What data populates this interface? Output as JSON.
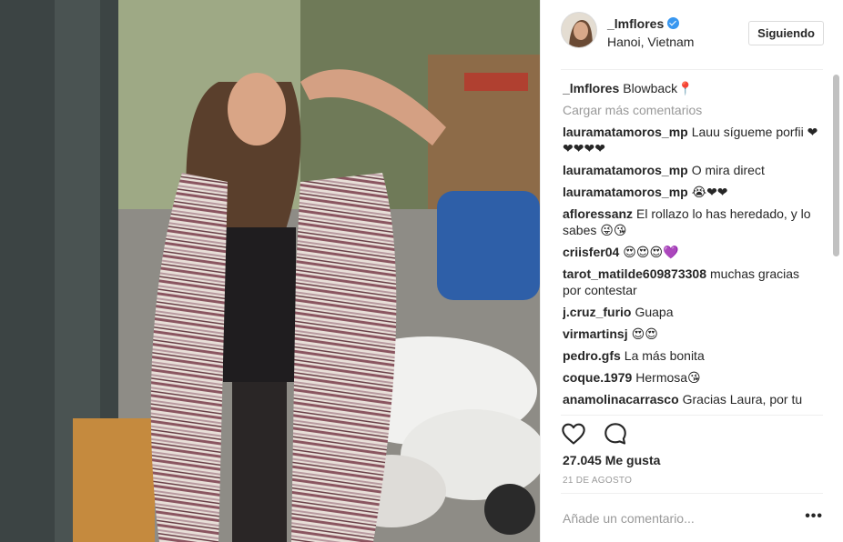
{
  "post": {
    "image_alt": "Photo: woman with striped kimono on a street with parked scooters"
  },
  "header": {
    "username": "_lmflores",
    "location": "Hanoi, Vietnam",
    "follow_label": "Siguiendo"
  },
  "caption": {
    "user": "_lmflores",
    "text": "Blowback📍"
  },
  "load_more": "Cargar más comentarios",
  "comments": [
    {
      "user": "lauramatamoros_mp",
      "text": "Lauu sígueme porfii ❤❤❤❤❤"
    },
    {
      "user": "lauramatamoros_mp",
      "text": "O mira direct"
    },
    {
      "user": "lauramatamoros_mp",
      "text": "😭❤❤"
    },
    {
      "user": "afloressanz",
      "text": "El rollazo lo has heredado, y lo sabes 😜😘"
    },
    {
      "user": "criisfer04",
      "text": "😍😍😍💜"
    },
    {
      "user": "tarot_matilde609873308",
      "text": "muchas gracias por contestar"
    },
    {
      "user": "j.cruz_furio",
      "text": "Guapa"
    },
    {
      "user": "virmartinsj",
      "text": "😍😍"
    },
    {
      "user": "pedro.gfs",
      "text": "La más bonita"
    },
    {
      "user": "coque.1979",
      "text": "Hermosa😘"
    },
    {
      "user": "anamolinacarrasco",
      "text": "Gracias Laura, por tu"
    }
  ],
  "likes": "27.045 Me gusta",
  "date": "21 DE AGOSTO",
  "add_comment_placeholder": "Añade un comentario...",
  "more_label": "•••",
  "icons": {
    "like": "heart-icon",
    "comment": "comment-icon",
    "verified": "verified-badge-icon"
  },
  "colors": {
    "accent": "#3897f0",
    "muted": "#999999",
    "text": "#262626"
  }
}
